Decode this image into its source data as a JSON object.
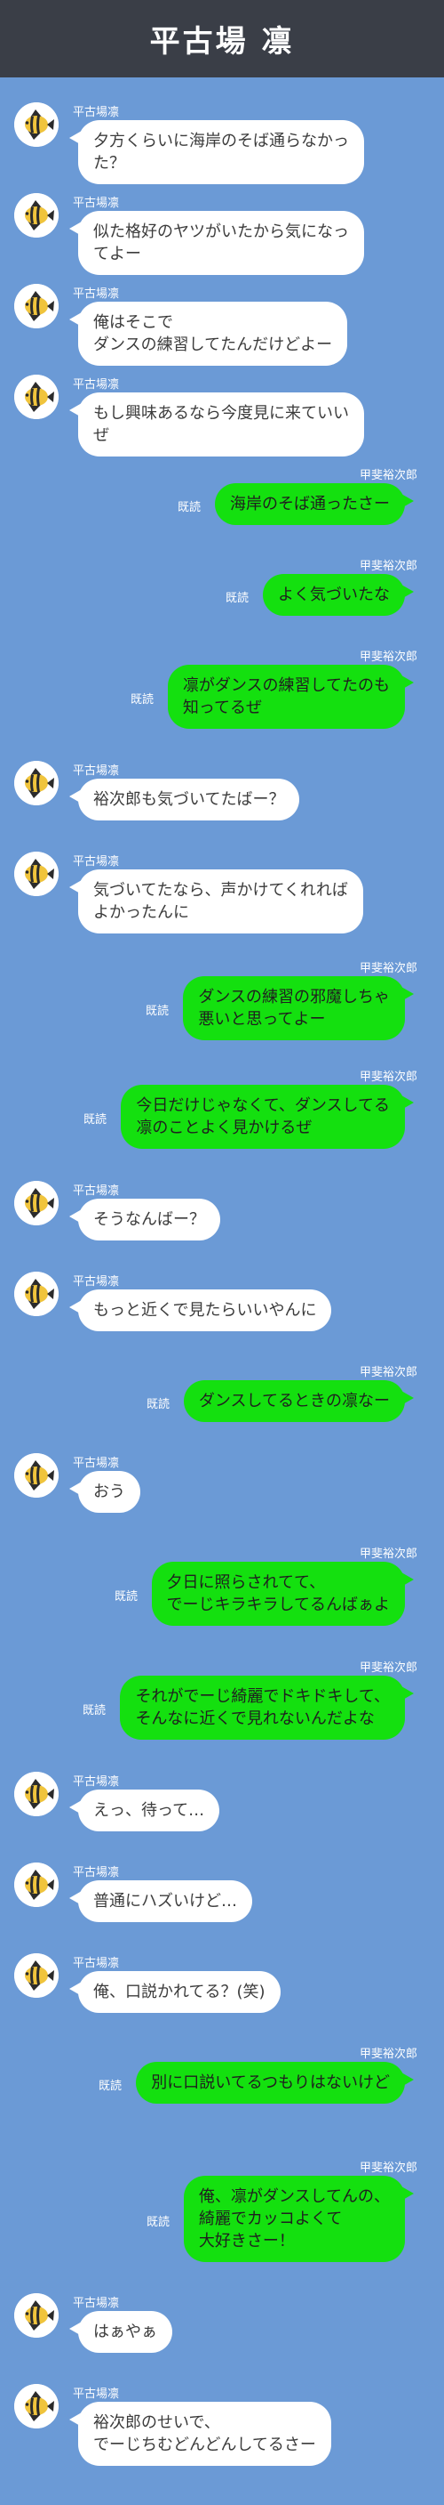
{
  "header": {
    "title": "平古場 凛"
  },
  "colors": {
    "background": "#6b9ad6",
    "header": "#3a3e47",
    "incoming_bubble": "#ffffff",
    "outgoing_bubble": "#14e00f"
  },
  "avatar_icon": "angelfish-icon",
  "read_label": "既読",
  "messages": [
    {
      "side": "left",
      "sender": "平古場凛",
      "lines": [
        "夕方くらいに海岸のそば通らなかっ",
        "た？"
      ]
    },
    {
      "side": "left",
      "sender": "平古場凛",
      "lines": [
        "似た格好のヤツがいたから気になっ",
        "てよー"
      ]
    },
    {
      "side": "left",
      "sender": "平古場凛",
      "lines": [
        "俺はそこで",
        "ダンスの練習してたんだけどよー"
      ]
    },
    {
      "side": "left",
      "sender": "平古場凛",
      "lines": [
        "もし興味あるなら今度見に来ていい",
        "ぜ"
      ]
    },
    {
      "side": "right",
      "sender": "甲斐裕次郎",
      "lines": [
        "海岸のそば通ったさー"
      ]
    },
    {
      "side": "right",
      "sender": "甲斐裕次郎",
      "lines": [
        "よく気づいたな"
      ]
    },
    {
      "side": "right",
      "sender": "甲斐裕次郎",
      "lines": [
        "凛がダンスの練習してたのも",
        "知ってるぜ"
      ]
    },
    {
      "side": "left",
      "sender": "平古場凛",
      "lines": [
        "裕次郎も気づいてたばー？"
      ]
    },
    {
      "side": "left",
      "sender": "平古場凛",
      "lines": [
        "気づいてたなら、声かけてくれれば",
        "よかったんに"
      ]
    },
    {
      "side": "right",
      "sender": "甲斐裕次郎",
      "lines": [
        "ダンスの練習の邪魔しちゃ",
        "悪いと思ってよー"
      ]
    },
    {
      "side": "right",
      "sender": "甲斐裕次郎",
      "lines": [
        "今日だけじゃなくて、ダンスしてる",
        "凛のことよく見かけるぜ"
      ]
    },
    {
      "side": "left",
      "sender": "平古場凛",
      "lines": [
        "そうなんばー？"
      ]
    },
    {
      "side": "left",
      "sender": "平古場凛",
      "lines": [
        "もっと近くで見たらいいやんに"
      ]
    },
    {
      "side": "right",
      "sender": "甲斐裕次郎",
      "lines": [
        "ダンスしてるときの凛なー"
      ]
    },
    {
      "side": "left",
      "sender": "平古場凛",
      "lines": [
        "おう"
      ]
    },
    {
      "side": "right",
      "sender": "甲斐裕次郎",
      "lines": [
        "夕日に照らされてて、",
        "でーじキラキラしてるんばぁよ"
      ]
    },
    {
      "side": "right",
      "sender": "甲斐裕次郎",
      "lines": [
        "それがでーじ綺麗でドキドキして、",
        "そんなに近くで見れないんだよな"
      ]
    },
    {
      "side": "left",
      "sender": "平古場凛",
      "lines": [
        "えっ、待って…"
      ]
    },
    {
      "side": "left",
      "sender": "平古場凛",
      "lines": [
        "普通にハズいけど…"
      ]
    },
    {
      "side": "left",
      "sender": "平古場凛",
      "lines": [
        "俺、口説かれてる？(笑)"
      ]
    },
    {
      "side": "right",
      "sender": "甲斐裕次郎",
      "lines": [
        "別に口説いてるつもりはないけど"
      ]
    },
    {
      "side": "right",
      "sender": "甲斐裕次郎",
      "lines": [
        "俺、凛がダンスしてんの、",
        "綺麗でカッコよくて",
        "大好きさー！"
      ]
    },
    {
      "side": "left",
      "sender": "平古場凛",
      "lines": [
        "はぁやぁ"
      ]
    },
    {
      "side": "left",
      "sender": "平古場凛",
      "lines": [
        "裕次郎のせいで、",
        "でーじちむどんどんしてるさー"
      ]
    }
  ]
}
